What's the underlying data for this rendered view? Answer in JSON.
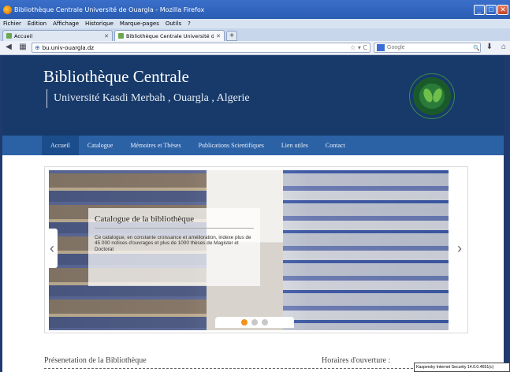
{
  "window": {
    "title": "Bibliothèque Centrale Université de Ouargla - Mozilla Firefox"
  },
  "menu": [
    "Fichier",
    "Édition",
    "Affichage",
    "Historique",
    "Marque-pages",
    "Outils",
    "?"
  ],
  "tabs": [
    {
      "label": "Accueil",
      "active": false
    },
    {
      "label": "Bibliothèque Centrale Université de Ouar...",
      "active": true
    }
  ],
  "toolbar": {
    "url": "bu.univ-ouargla.dz",
    "search_placeholder": "Google"
  },
  "site": {
    "title": "Bibliothèque Centrale",
    "subtitle": "Université Kasdi Merbah , Ouargla , Algerie"
  },
  "nav": [
    {
      "label": "Accueil",
      "active": true
    },
    {
      "label": "Catalogue",
      "active": false
    },
    {
      "label": "Mémoires et Thèses",
      "active": false
    },
    {
      "label": "Publications Scientifiques",
      "active": false
    },
    {
      "label": "Lien utiles",
      "active": false
    },
    {
      "label": "Contact",
      "active": false
    }
  ],
  "slider": {
    "caption_title": "Catalogue de la bibliothèque",
    "caption_text": "Ce catalogue, en constante croissance et amélioration, indexe plus de 45 000 notices d'ouvrages et plus de 1000 thèses de Magister et Doctorat",
    "active_dot": 1,
    "dot_count": 3
  },
  "sections": {
    "presentation": "Présenetation de la Bibliothèque",
    "horaires": "Horaires d'ouverture :"
  },
  "kaspersky": "Kaspersky Internet Security 14.0.0.4651(c)",
  "colors": {
    "header": "#173a6a",
    "nav": "#2b62a6",
    "active_dot": "#f0921c"
  }
}
